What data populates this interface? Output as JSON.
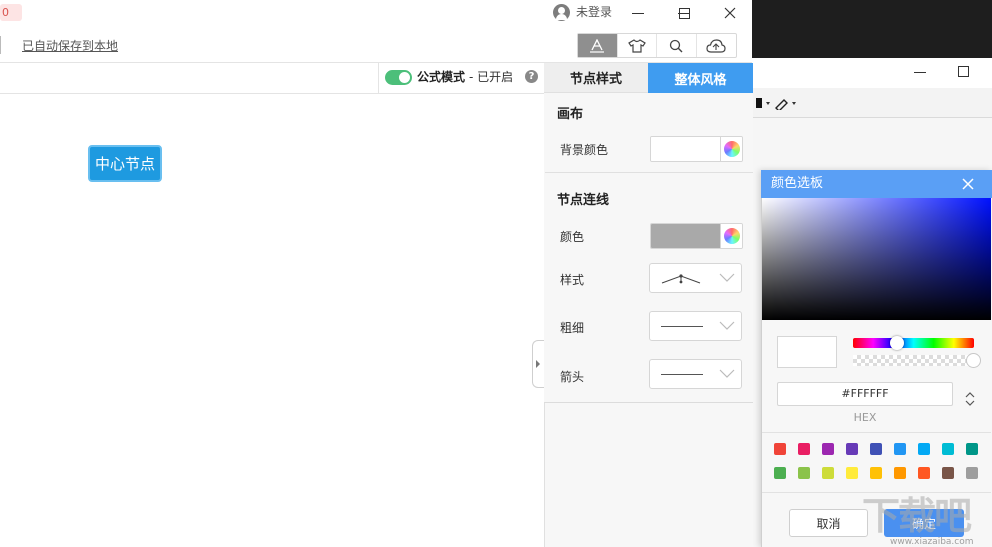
{
  "titlebar": {
    "badge": "0",
    "user_label": "未登录"
  },
  "toolbar": {
    "autosave_label": "已自动保存到本地",
    "tools": [
      "text-style-icon",
      "theme-shirt-icon",
      "search-icon",
      "cloud-icon"
    ]
  },
  "subbar": {
    "formula_label": "公式模式",
    "formula_status": "- 已开启",
    "help": "?"
  },
  "canvas": {
    "center_node": "中心节点"
  },
  "panel": {
    "tabs": [
      {
        "label": "节点样式"
      },
      {
        "label": "整体风格"
      }
    ],
    "canvas_section": "画布",
    "bg_color_label": "背景颜色",
    "bg_color": "#ffffff",
    "line_section": "节点连线",
    "color_label": "颜色",
    "line_color": "#a9a9a9",
    "style_label": "样式",
    "width_label": "粗细",
    "arrow_label": "箭头"
  },
  "picker": {
    "title": "颜色选板",
    "hex_value": "#FFFFFF",
    "hex_label": "HEX",
    "palette": [
      "#f04438",
      "#e91e63",
      "#9c27b0",
      "#673ab7",
      "#3f51b5",
      "#2196f3",
      "#03a9f4",
      "#00bcd4",
      "#009688",
      "#4caf50",
      "#8bc34a",
      "#cddc39",
      "#ffeb3b",
      "#ffc107",
      "#ff9800",
      "#ff5722",
      "#795548",
      "#9e9e9e"
    ],
    "cancel_label": "取消",
    "ok_label": "确定"
  },
  "watermark": {
    "text": "下载吧",
    "url": "www.xiazaiba.com"
  }
}
